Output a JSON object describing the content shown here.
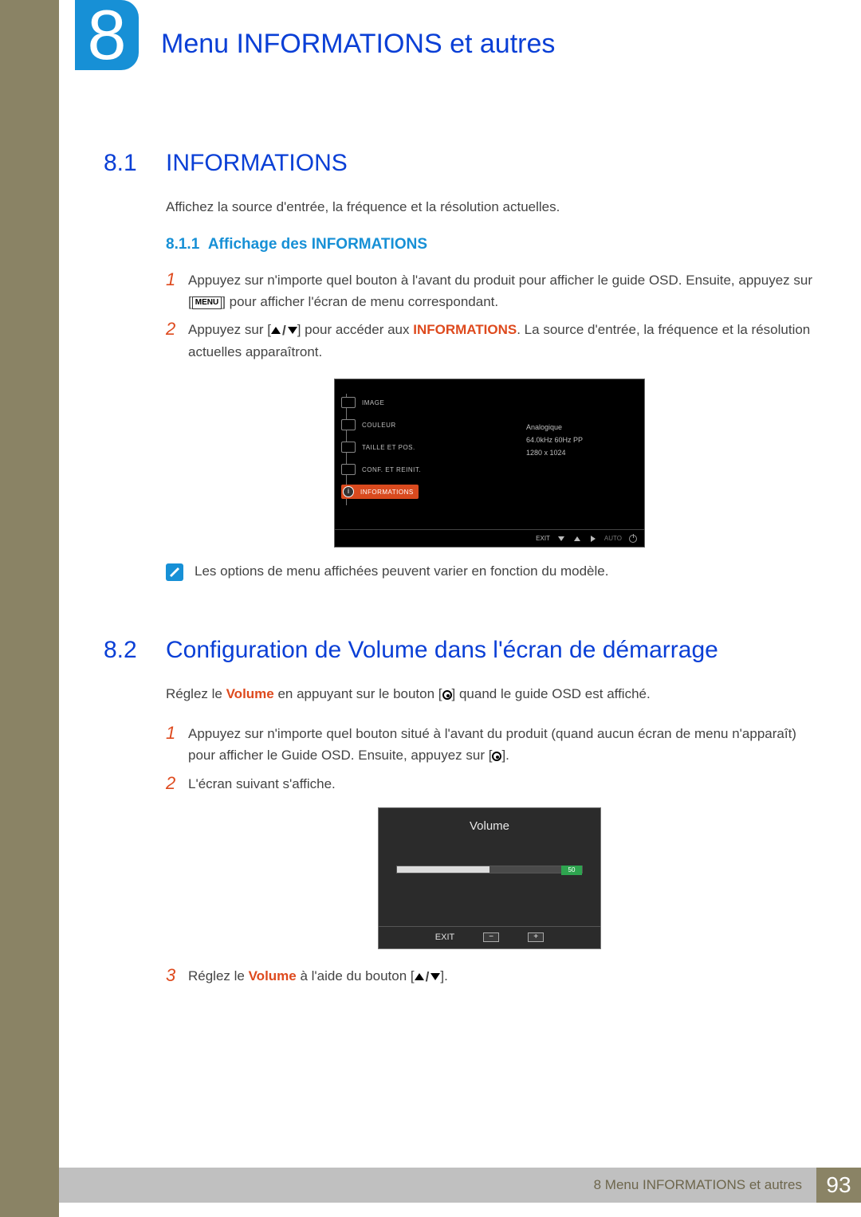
{
  "chapter": {
    "number": "8",
    "title": "Menu INFORMATIONS et autres"
  },
  "section_1": {
    "num": "8.1",
    "title": "INFORMATIONS",
    "intro": "Affichez la source d'entrée, la fréquence et la résolution actuelles.",
    "sub": {
      "num": "8.1.1",
      "title": "Affichage des INFORMATIONS"
    },
    "step1_a": "Appuyez sur n'importe quel bouton à l'avant du produit pour afficher le guide OSD. Ensuite, appuyez sur [",
    "step1_menu": "MENU",
    "step1_b": "] pour afficher l'écran de menu correspondant.",
    "step2_a": "Appuyez sur [",
    "step2_b": "] pour accéder aux ",
    "step2_c": "INFORMATIONS",
    "step2_d": ". La source d'entrée, la fréquence et la résolution actuelles apparaîtront.",
    "note": "Les options de menu affichées peuvent varier en fonction du modèle."
  },
  "osd1": {
    "menu": [
      "IMAGE",
      "COULEUR",
      "TAILLE ET POS.",
      "CONF. ET REINIT.",
      "INFORMATIONS"
    ],
    "info": [
      "Analogique",
      "64.0kHz 60Hz PP",
      "1280 x 1024"
    ],
    "buttons": {
      "exit": "EXIT",
      "auto": "AUTO"
    }
  },
  "section_2": {
    "num": "8.2",
    "title": "Configuration de Volume dans l'écran de démarrage",
    "intro_a": "Réglez le ",
    "intro_vol": "Volume",
    "intro_b": " en appuyant sur le bouton [",
    "intro_c": "] quand le guide OSD est affiché.",
    "step1_a": "Appuyez sur n'importe quel bouton situé à l'avant du produit (quand aucun écran de menu n'apparaît) pour afficher le Guide OSD. Ensuite, appuyez sur [",
    "step1_b": "].",
    "step2": "L'écran suivant s'affiche.",
    "step3_a": "Réglez le ",
    "step3_vol": "Volume",
    "step3_b": " à l'aide du bouton [",
    "step3_c": "]."
  },
  "osd2": {
    "title": "Volume",
    "value": "50",
    "exit": "EXIT"
  },
  "footer": {
    "label": "8 Menu INFORMATIONS et autres",
    "page": "93"
  }
}
